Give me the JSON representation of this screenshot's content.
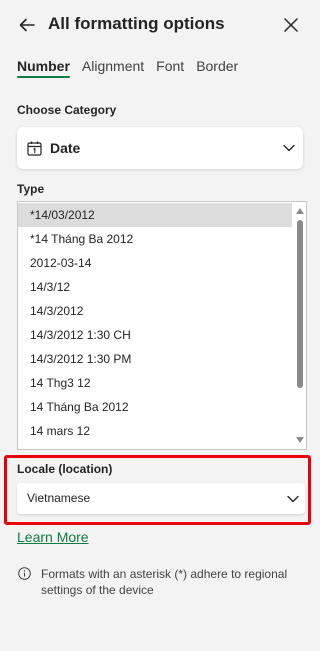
{
  "header": {
    "title": "All formatting options",
    "back_icon": "back-arrow-icon",
    "close_icon": "close-icon"
  },
  "tabs": [
    {
      "label": "Number",
      "active": true
    },
    {
      "label": "Alignment",
      "active": false
    },
    {
      "label": "Font",
      "active": false
    },
    {
      "label": "Border",
      "active": false
    }
  ],
  "category": {
    "label": "Choose Category",
    "value": "Date",
    "icon": "calendar-icon"
  },
  "type": {
    "label": "Type",
    "items": [
      "*14/03/2012",
      "*14 Tháng Ba 2012",
      "2012-03-14",
      "14/3/12",
      "14/3/2012",
      "14/3/2012 1:30 CH",
      "14/3/2012 1:30 PM",
      "14 Thg3 12",
      "14 Tháng Ba 2012",
      "14 mars 12"
    ],
    "selected_index": 0
  },
  "locale": {
    "label": "Locale (location)",
    "value": "Vietnamese"
  },
  "learn_more": "Learn More",
  "info": {
    "icon": "info-icon",
    "text": "Formats with an asterisk (*) adhere to regional settings of the device"
  },
  "colors": {
    "accent": "#107c41",
    "highlight_border": "#e8000b",
    "background": "#f3f3f3"
  }
}
